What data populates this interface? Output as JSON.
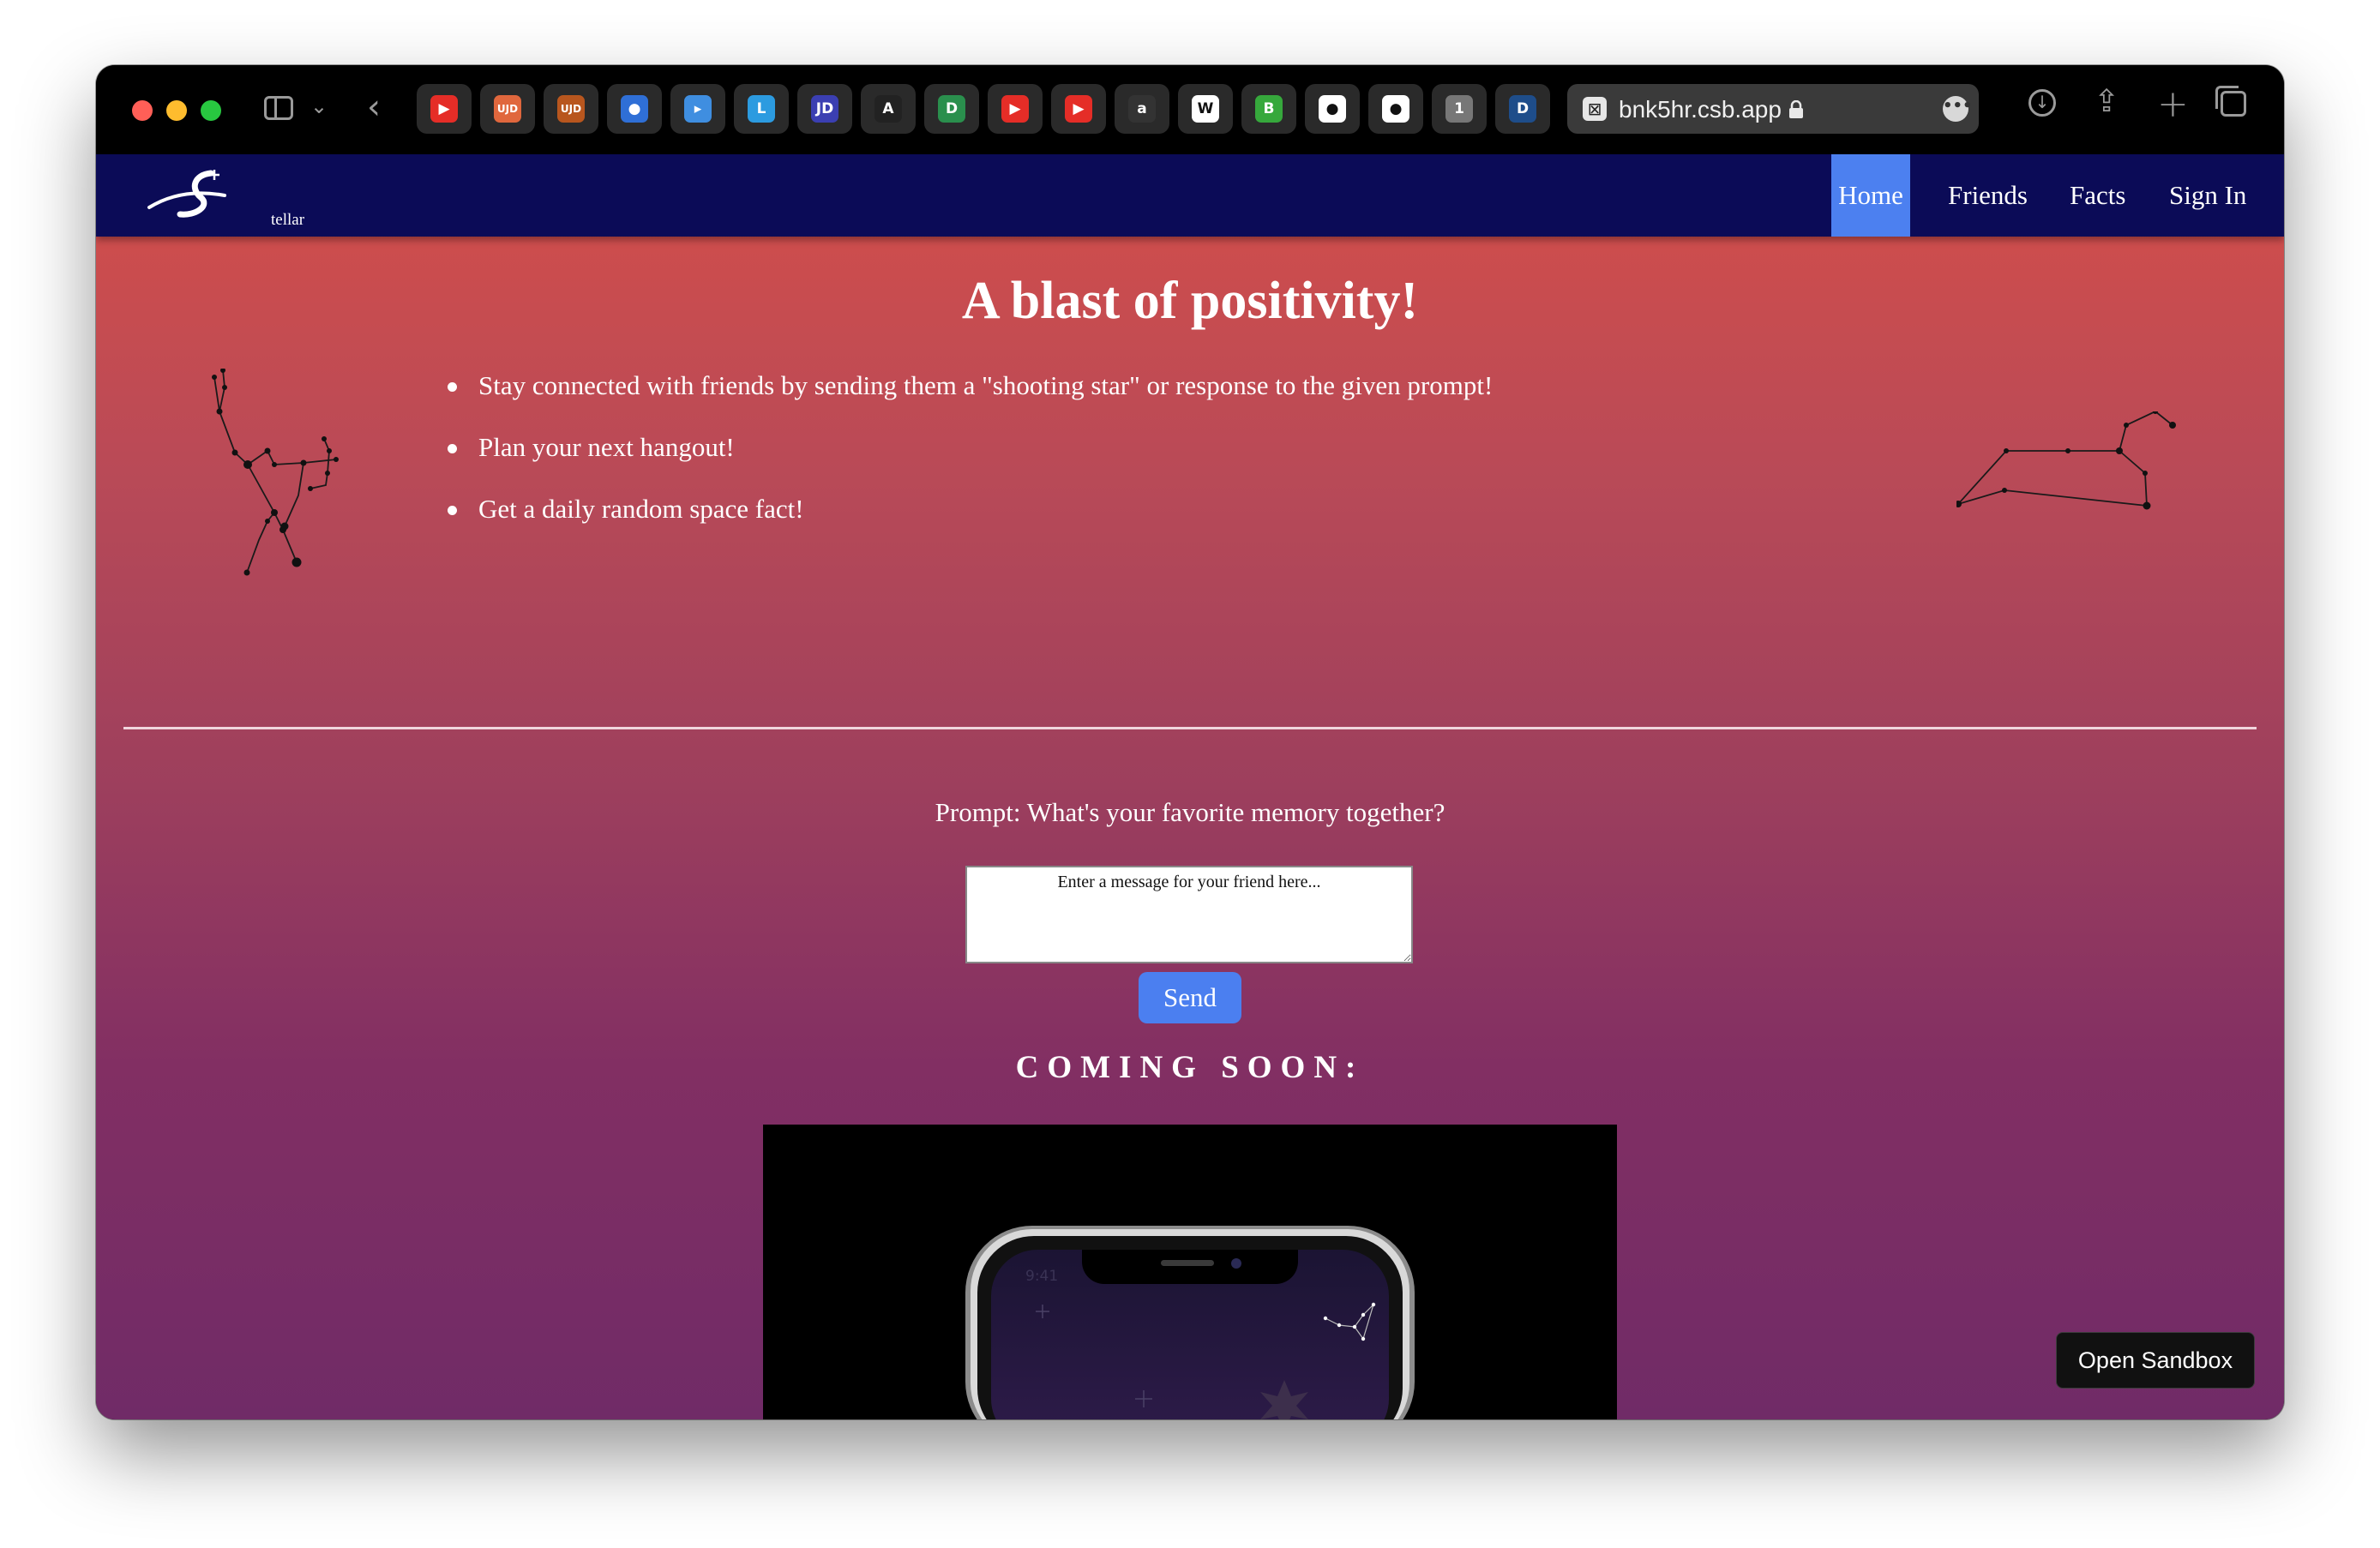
{
  "browser": {
    "url": "bnk5hr.csb.app",
    "tabs": [
      {
        "icon": "youtube-icon",
        "text": "▶",
        "color": "#e52d27"
      },
      {
        "icon": "ujd-orange-icon",
        "text": "UJD",
        "color": "#e0673d"
      },
      {
        "icon": "ujd-dark-icon",
        "text": "UJD",
        "color": "#b8561e"
      },
      {
        "icon": "blue-dot-icon",
        "text": "●",
        "color": "#2f6fd6"
      },
      {
        "icon": "bookmark-blue-icon",
        "text": "▸",
        "color": "#3f8ee0"
      },
      {
        "icon": "blue-letter-icon",
        "text": "L",
        "color": "#2c9be0"
      },
      {
        "icon": "jd-icon",
        "text": "JD",
        "color": "#3b3fb2"
      },
      {
        "icon": "angular-icon",
        "text": "A",
        "color": "#222222"
      },
      {
        "icon": "green-d-icon",
        "text": "D",
        "color": "#2a8f4d"
      },
      {
        "icon": "youtube-icon",
        "text": "▶",
        "color": "#e52d27"
      },
      {
        "icon": "youtube-icon",
        "text": "▶",
        "color": "#e52d27"
      },
      {
        "icon": "a-circle-icon",
        "text": "a",
        "color": "#333333"
      },
      {
        "icon": "wikipedia-icon",
        "text": "W",
        "color": "#ffffff"
      },
      {
        "icon": "green-square-icon",
        "text": "B",
        "color": "#36a83c"
      },
      {
        "icon": "github-icon",
        "text": "●",
        "color": "#ffffff"
      },
      {
        "icon": "github-icon",
        "text": "●",
        "color": "#ffffff"
      },
      {
        "icon": "number-one-icon",
        "text": "1",
        "color": "#777777"
      },
      {
        "icon": "d-circle-icon",
        "text": "D",
        "color": "#1e4d8a"
      }
    ]
  },
  "nav": {
    "logo_letter": "S",
    "logo_sub": "tellar",
    "home": "Home",
    "friends": "Friends",
    "facts": "Facts",
    "sign_in": "Sign In"
  },
  "hero": {
    "title": "A blast of positivity!",
    "features": [
      "Stay connected with friends by sending them a \"shooting star\" or response to the given prompt!",
      "Plan your next hangout!",
      "Get a daily random space fact!"
    ]
  },
  "prompt": {
    "text": "Prompt: What's your favorite memory together?",
    "placeholder": "Enter a message for your friend here...",
    "send_label": "Send"
  },
  "coming_soon": {
    "title": "COMING SOON:",
    "phone_time": "9:41"
  },
  "open_sandbox": "Open Sandbox",
  "colors": {
    "nav_bg": "#0b0b57",
    "accent_blue": "#4b7ff0",
    "gradient_top": "#d44e49",
    "gradient_bottom": "#702b67"
  }
}
